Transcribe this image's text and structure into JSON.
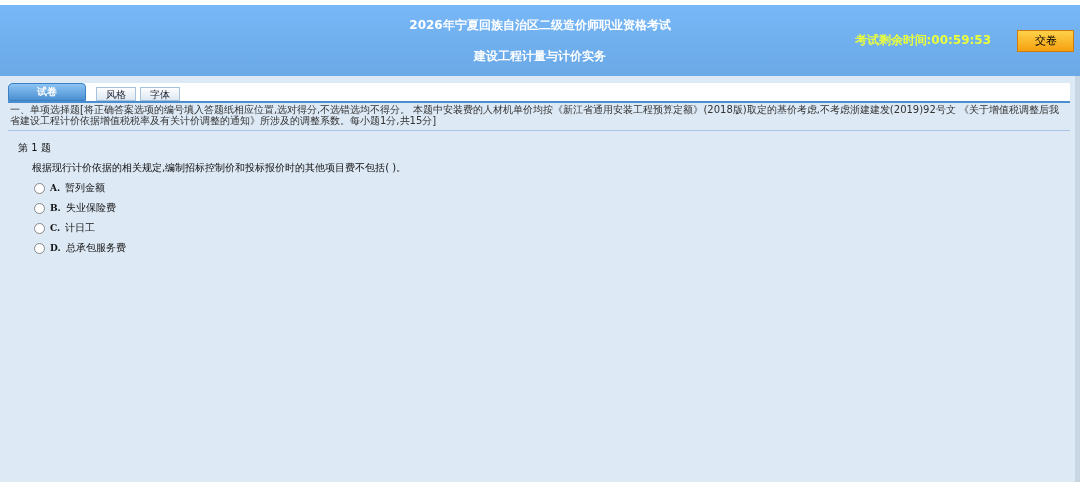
{
  "header": {
    "exam_title": "2026年宁夏回族自治区二级造价师职业资格考试",
    "subject": "建设工程计量与计价实务",
    "timer": "考试剩余时间:00:59:53",
    "submit_button": "交卷"
  },
  "tabs": [
    {
      "label": "试卷",
      "selected": true
    },
    {
      "label": "风格",
      "selected": false
    },
    {
      "label": "字体",
      "selected": false
    }
  ],
  "instructions": "一、单项选择题[将正确答案选项的编号填入答题纸相应位置,选对得分,不选错选均不得分。 本题中安装费的人材机单价均按《新江省通用安装工程预算定额》(2018版)取定的基价考虑,不考虑浙建建发(2019)92号文 《关于增值税调整后我省建设工程计价依据增值税税率及有关计价调整的通知》所涉及的调整系数。每小题1分,共15分]",
  "question": {
    "number": "第 1 题",
    "text": "根据现行计价依据的相关规定,编制招标控制价和投标报价时的其他项目费不包括( )。",
    "options": [
      {
        "letter": "A.",
        "text": "暂列金额",
        "selected": false
      },
      {
        "letter": "B.",
        "text": "失业保险费",
        "selected": false
      },
      {
        "letter": "C.",
        "text": "计日工",
        "selected": false
      },
      {
        "letter": "D.",
        "text": "总承包服务费",
        "selected": false
      }
    ]
  }
}
